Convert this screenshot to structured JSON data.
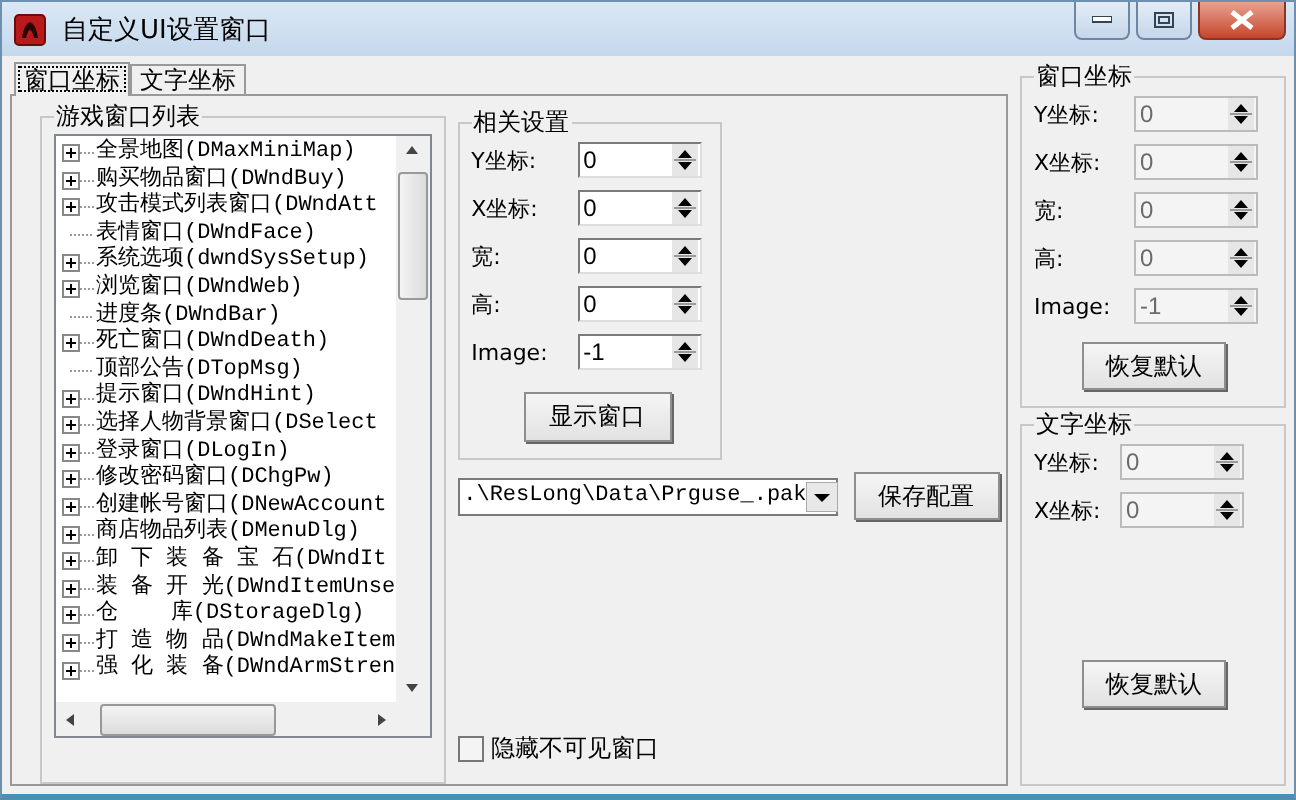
{
  "window": {
    "title": "自定义UI设置窗口"
  },
  "tabs": [
    {
      "label": "窗口坐标",
      "selected": true
    },
    {
      "label": "文字坐标",
      "selected": false
    }
  ],
  "window_list": {
    "title": "游戏窗口列表",
    "items": [
      {
        "label": "全景地图(DMaxMiniMap)",
        "kind": "group"
      },
      {
        "label": "购买物品窗口(DWndBuy)",
        "kind": "group"
      },
      {
        "label": "攻击模式列表窗口(DWndAtt",
        "kind": "group"
      },
      {
        "label": "表情窗口(DWndFace)",
        "kind": "leaf"
      },
      {
        "label": "系统选项(dwndSysSetup)",
        "kind": "group"
      },
      {
        "label": "浏览窗口(DWndWeb)",
        "kind": "group"
      },
      {
        "label": "进度条(DWndBar)",
        "kind": "leaf"
      },
      {
        "label": "死亡窗口(DWndDeath)",
        "kind": "group"
      },
      {
        "label": "顶部公告(DTopMsg)",
        "kind": "leaf"
      },
      {
        "label": "提示窗口(DWndHint)",
        "kind": "group"
      },
      {
        "label": "选择人物背景窗口(DSelect",
        "kind": "group"
      },
      {
        "label": "登录窗口(DLogIn)",
        "kind": "group"
      },
      {
        "label": "修改密码窗口(DChgPw)",
        "kind": "group"
      },
      {
        "label": "创建帐号窗口(DNewAccount",
        "kind": "group"
      },
      {
        "label": "商店物品列表(DMenuDlg)",
        "kind": "group"
      },
      {
        "label": "卸 下 装 备 宝 石(DWndIt",
        "kind": "group"
      },
      {
        "label": "装 备 开 光(DWndItemUnse",
        "kind": "group"
      },
      {
        "label": "仓    库(DStorageDlg)",
        "kind": "group"
      },
      {
        "label": "打 造 物 品(DWndMakeItem",
        "kind": "group"
      },
      {
        "label": "强 化 装 备(DWndArmStren",
        "kind": "group"
      }
    ]
  },
  "settings": {
    "title": "相关设置",
    "fields": [
      {
        "label": "Y坐标:",
        "value": "0",
        "disabled": false
      },
      {
        "label": "X坐标:",
        "value": "0",
        "disabled": false
      },
      {
        "label": "宽:",
        "value": "0",
        "disabled": false
      },
      {
        "label": "高:",
        "value": "0",
        "disabled": false
      },
      {
        "label": "Image:",
        "value": "-1",
        "disabled": false
      }
    ],
    "button": "显示窗口"
  },
  "path_select": {
    "value": ".\\ResLong\\Data\\Prguse_.pak"
  },
  "save_button": "保存配置",
  "hide_checkbox": {
    "label": "隐藏不可见窗口",
    "checked": false
  },
  "window_coords": {
    "title": "窗口坐标",
    "fields": [
      {
        "label": "Y坐标:",
        "value": "0",
        "disabled": true
      },
      {
        "label": "X坐标:",
        "value": "0",
        "disabled": true
      },
      {
        "label": "宽:",
        "value": "0",
        "disabled": true
      },
      {
        "label": "高:",
        "value": "0",
        "disabled": true
      },
      {
        "label": "Image:",
        "value": "-1",
        "disabled": true
      }
    ],
    "button": "恢复默认"
  },
  "text_coords": {
    "title": "文字坐标",
    "fields": [
      {
        "label": "Y坐标:",
        "value": "0",
        "disabled": true
      },
      {
        "label": "X坐标:",
        "value": "0",
        "disabled": true
      }
    ],
    "button": "恢复默认"
  }
}
